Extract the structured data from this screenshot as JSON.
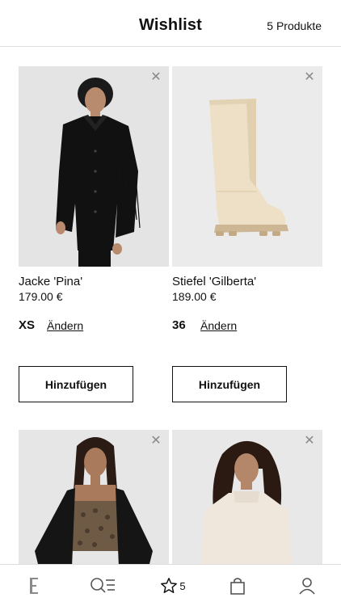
{
  "header": {
    "title": "Wishlist",
    "count": "5 Produkte"
  },
  "products": [
    {
      "name": "Jacke 'Pina'",
      "price": "179.00 €",
      "size": "XS",
      "change_label": "Ändern",
      "add_label": "Hinzufügen"
    },
    {
      "name": "Stiefel 'Gilberta'",
      "price": "189.00 €",
      "size": "36",
      "change_label": "Ändern",
      "add_label": "Hinzufügen"
    },
    {
      "name": "",
      "price": "",
      "size": "",
      "change_label": "",
      "add_label": ""
    },
    {
      "name": "",
      "price": "",
      "size": "",
      "change_label": "",
      "add_label": ""
    }
  ],
  "nav": {
    "items": [
      {
        "icon": "edited-logo-icon"
      },
      {
        "icon": "search-categories-icon"
      },
      {
        "icon": "star-icon",
        "badge": "5"
      },
      {
        "icon": "shopping-bag-icon"
      },
      {
        "icon": "user-icon"
      }
    ]
  },
  "colors": {
    "accent": "#111111",
    "image_background": "#e5e5e5"
  }
}
